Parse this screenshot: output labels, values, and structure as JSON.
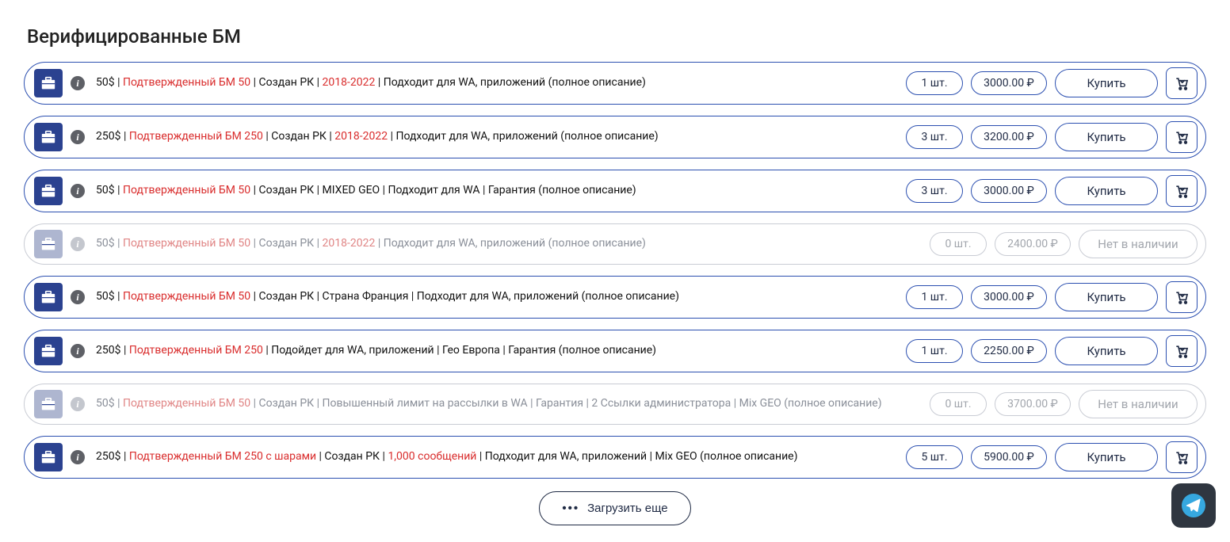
{
  "section_title": "Верифицированные БМ",
  "labels": {
    "buy": "Купить",
    "out_of_stock": "Нет в наличии",
    "load_more": "Загрузить еще"
  },
  "products": [
    {
      "available": true,
      "segments": [
        {
          "text": "50$",
          "red": false
        },
        {
          "text": "Подтвержденный БМ 50",
          "red": true
        },
        {
          "text": "Создан РК",
          "red": false
        },
        {
          "text": "2018-2022",
          "red": true
        },
        {
          "text": "Подходит для WA, приложений (полное описание)",
          "red": false
        }
      ],
      "qty": "1 шт.",
      "price": "3000.00 ₽"
    },
    {
      "available": true,
      "segments": [
        {
          "text": "250$",
          "red": false
        },
        {
          "text": "Подтвержденный БМ 250",
          "red": true
        },
        {
          "text": "Создан РК",
          "red": false
        },
        {
          "text": "2018-2022",
          "red": true
        },
        {
          "text": "Подходит для WA, приложений (полное описание)",
          "red": false
        }
      ],
      "qty": "3 шт.",
      "price": "3200.00 ₽"
    },
    {
      "available": true,
      "segments": [
        {
          "text": "50$",
          "red": false
        },
        {
          "text": "Подтвержденный БМ 50",
          "red": true
        },
        {
          "text": "Создан РК | MIXED GEO | Подходит для WA | Гарантия (полное описание)",
          "red": false
        }
      ],
      "qty": "3 шт.",
      "price": "3000.00 ₽"
    },
    {
      "available": false,
      "segments": [
        {
          "text": "50$",
          "red": false
        },
        {
          "text": "Подтвержденный БМ 50",
          "red": true
        },
        {
          "text": "Создан РК",
          "red": false
        },
        {
          "text": "2018-2022",
          "red": true
        },
        {
          "text": "Подходит для WA, приложений (полное описание)",
          "red": false
        }
      ],
      "qty": "0 шт.",
      "price": "2400.00 ₽"
    },
    {
      "available": true,
      "segments": [
        {
          "text": "50$",
          "red": false
        },
        {
          "text": "Подтвержденный БМ 50",
          "red": true
        },
        {
          "text": "Создан РК | Страна Франция | Подходит для WA, приложений (полное описание)",
          "red": false
        }
      ],
      "qty": "1 шт.",
      "price": "3000.00 ₽"
    },
    {
      "available": true,
      "segments": [
        {
          "text": "250$",
          "red": false
        },
        {
          "text": "Подтвержденный БМ 250",
          "red": true
        },
        {
          "text": "Подойдет для WA, приложений | Гео Европа | Гарантия (полное описание)",
          "red": false
        }
      ],
      "qty": "1 шт.",
      "price": "2250.00 ₽"
    },
    {
      "available": false,
      "segments": [
        {
          "text": "50$",
          "red": false
        },
        {
          "text": "Подтвержденный БМ 50",
          "red": true
        },
        {
          "text": "Создан РК | Повышенный лимит на рассылки в WA | Гарантия | 2 Ссылки администратора | Mix GEO (полное описание)",
          "red": false
        }
      ],
      "qty": "0 шт.",
      "price": "3700.00 ₽"
    },
    {
      "available": true,
      "segments": [
        {
          "text": "250$",
          "red": false
        },
        {
          "text": "Подтвержденный БМ 250 с шарами",
          "red": true
        },
        {
          "text": "Создан РК",
          "red": false
        },
        {
          "text": "1,000 сообщений",
          "red": true
        },
        {
          "text": "Подходит для WA, приложений | Mix GEO (полное описание)",
          "red": false
        }
      ],
      "qty": "5 шт.",
      "price": "5900.00 ₽"
    }
  ]
}
